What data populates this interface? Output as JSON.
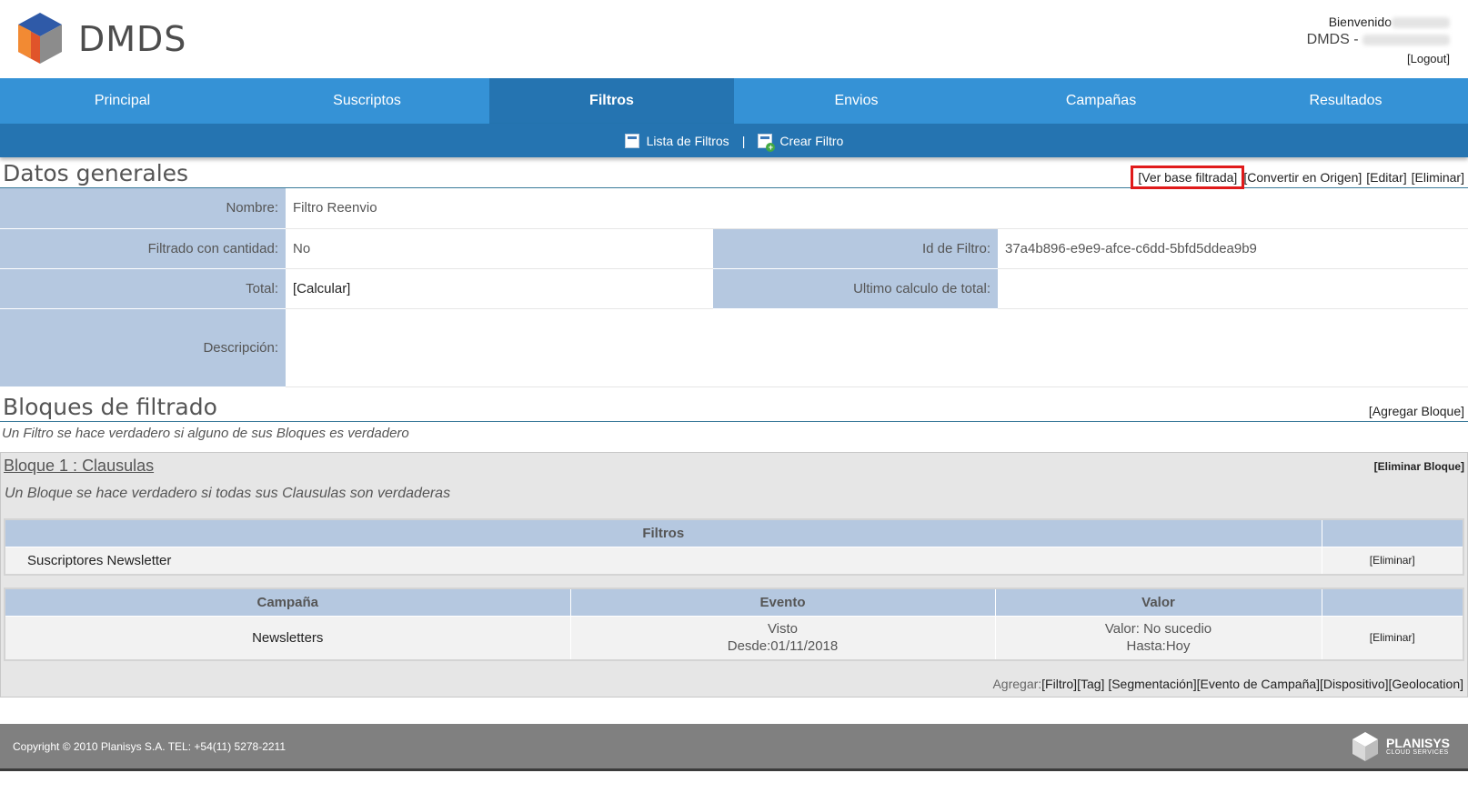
{
  "brand": {
    "logo_text": "DMDS"
  },
  "user": {
    "welcome": "Bienvenido",
    "org_prefix": "DMDS -",
    "logout": "[Logout]"
  },
  "nav": {
    "items": [
      {
        "label": "Principal"
      },
      {
        "label": "Suscriptos"
      },
      {
        "label": "Filtros",
        "active": true
      },
      {
        "label": "Envios"
      },
      {
        "label": "Campañas"
      },
      {
        "label": "Resultados"
      }
    ]
  },
  "subnav": {
    "list_label": "Lista de Filtros",
    "separator": "|",
    "create_label": "Crear Filtro"
  },
  "datos": {
    "title": "Datos generales",
    "actions": {
      "ver_base": "[Ver base filtrada]",
      "convertir": "[Convertir en Origen]",
      "editar": "[Editar]",
      "eliminar": "[Eliminar]"
    },
    "nombre_label": "Nombre:",
    "nombre_value": "Filtro Reenvio",
    "filtrado_label": "Filtrado con cantidad:",
    "filtrado_value": "No",
    "id_label": "Id de Filtro:",
    "id_value": "37a4b896-e9e9-afce-c6dd-5bfd5ddea9b9",
    "total_label": "Total:",
    "total_value": "[Calcular]",
    "ultimo_label": "Ultimo calculo de total:",
    "ultimo_value": "",
    "desc_label": "Descripción:",
    "desc_value": ""
  },
  "bloques": {
    "title": "Bloques de filtrado",
    "add": "[Agregar Bloque]",
    "note": "Un Filtro se hace verdadero si alguno de sus Bloques es verdadero",
    "bloque1": {
      "title": "Bloque 1 : Clausulas",
      "delete": "[Eliminar Bloque]",
      "note": "Un Bloque se hace verdadero si todas sus Clausulas son verdaderas",
      "filtros": {
        "header": "Filtros",
        "row": "Suscriptores Newsletter",
        "delete": "[Eliminar]"
      },
      "campaign": {
        "headers": [
          "Campaña",
          "Evento",
          "Valor"
        ],
        "campana": "Newsletters",
        "evento_1": "Visto",
        "evento_2": "Desde:01/11/2018",
        "valor_1": "Valor: No sucedio",
        "valor_2": "Hasta:Hoy",
        "delete": "[Eliminar]"
      },
      "agregar": {
        "label": "Agregar:",
        "links": [
          "[Filtro]",
          "[Tag]",
          "[Segmentación]",
          "[Evento de Campaña]",
          "[Dispositivo]",
          "[Geolocation]"
        ]
      }
    }
  },
  "footer": {
    "copyright": "Copyright © 2010 Planisys S.A. TEL: +54(11) 5278-2211",
    "brand": "PLANISYS",
    "brand_sub": "CLOUD SERVICES"
  },
  "colors": {
    "nav": "#3592d6",
    "nav_active": "#2574b1",
    "label_bg": "#b5c8e0",
    "highlight": "#e01a1a",
    "footer": "#808080"
  }
}
